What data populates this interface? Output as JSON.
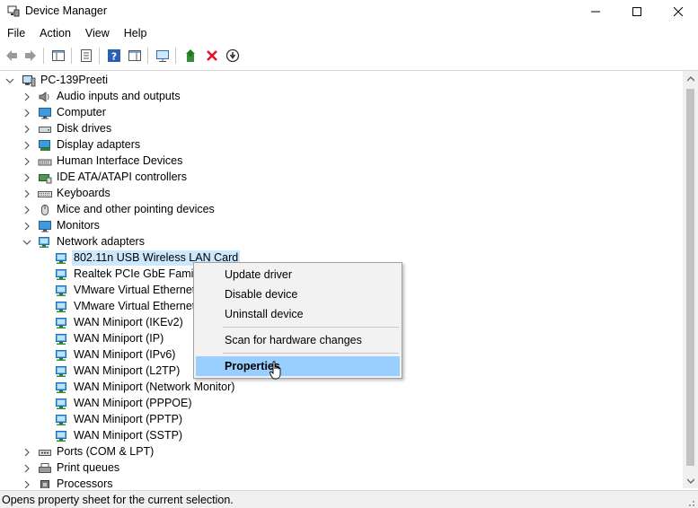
{
  "window": {
    "title": "Device Manager",
    "app_icon": "device-manager-icon"
  },
  "menu": [
    "File",
    "Action",
    "View",
    "Help"
  ],
  "toolbar": {
    "icons": [
      "back-icon",
      "forward-icon",
      "show-hide-console-tree-icon",
      "properties-icon",
      "help-icon",
      "action-pane-icon",
      "scan-hardware-icon",
      "update-driver-icon",
      "uninstall-icon",
      "disable-device-icon"
    ]
  },
  "tree": {
    "root": "PC-139Preeti",
    "categories": [
      {
        "label": "Audio inputs and outputs",
        "icon": "speaker-icon"
      },
      {
        "label": "Computer",
        "icon": "computer-icon"
      },
      {
        "label": "Disk drives",
        "icon": "disk-drive-icon"
      },
      {
        "label": "Display adapters",
        "icon": "display-adapter-icon"
      },
      {
        "label": "Human Interface Devices",
        "icon": "hid-icon"
      },
      {
        "label": "IDE ATA/ATAPI controllers",
        "icon": "ide-controller-icon"
      },
      {
        "label": "Keyboards",
        "icon": "keyboard-icon"
      },
      {
        "label": "Mice and other pointing devices",
        "icon": "mouse-icon"
      },
      {
        "label": "Monitors",
        "icon": "monitor-icon"
      },
      {
        "label": "Network adapters",
        "icon": "network-adapter-icon",
        "expanded": true
      }
    ],
    "network_adapters": [
      "802.11n USB Wireless LAN Card",
      "Realtek PCIe GbE Family C",
      "VMware Virtual Ethernet A",
      "VMware Virtual Ethernet A",
      "WAN Miniport (IKEv2)",
      "WAN Miniport (IP)",
      "WAN Miniport (IPv6)",
      "WAN Miniport (L2TP)",
      "WAN Miniport (Network Monitor)",
      "WAN Miniport (PPPOE)",
      "WAN Miniport (PPTP)",
      "WAN Miniport (SSTP)"
    ],
    "after": [
      {
        "label": "Ports (COM & LPT)",
        "icon": "port-icon"
      },
      {
        "label": "Print queues",
        "icon": "printer-icon"
      },
      {
        "label": "Processors",
        "icon": "processor-icon"
      }
    ],
    "selected": "802.11n USB Wireless LAN Card"
  },
  "context_menu": {
    "items": [
      "Update driver",
      "Disable device",
      "Uninstall device",
      "Scan for hardware changes",
      "Properties"
    ],
    "highlighted": "Properties"
  },
  "status": {
    "text": "Opens property sheet for the current selection."
  },
  "colors": {
    "selection": "#cce8ff",
    "menu_highlight": "#99cfff",
    "network_icon": "#2b8fd6",
    "error_red": "#e81123"
  }
}
